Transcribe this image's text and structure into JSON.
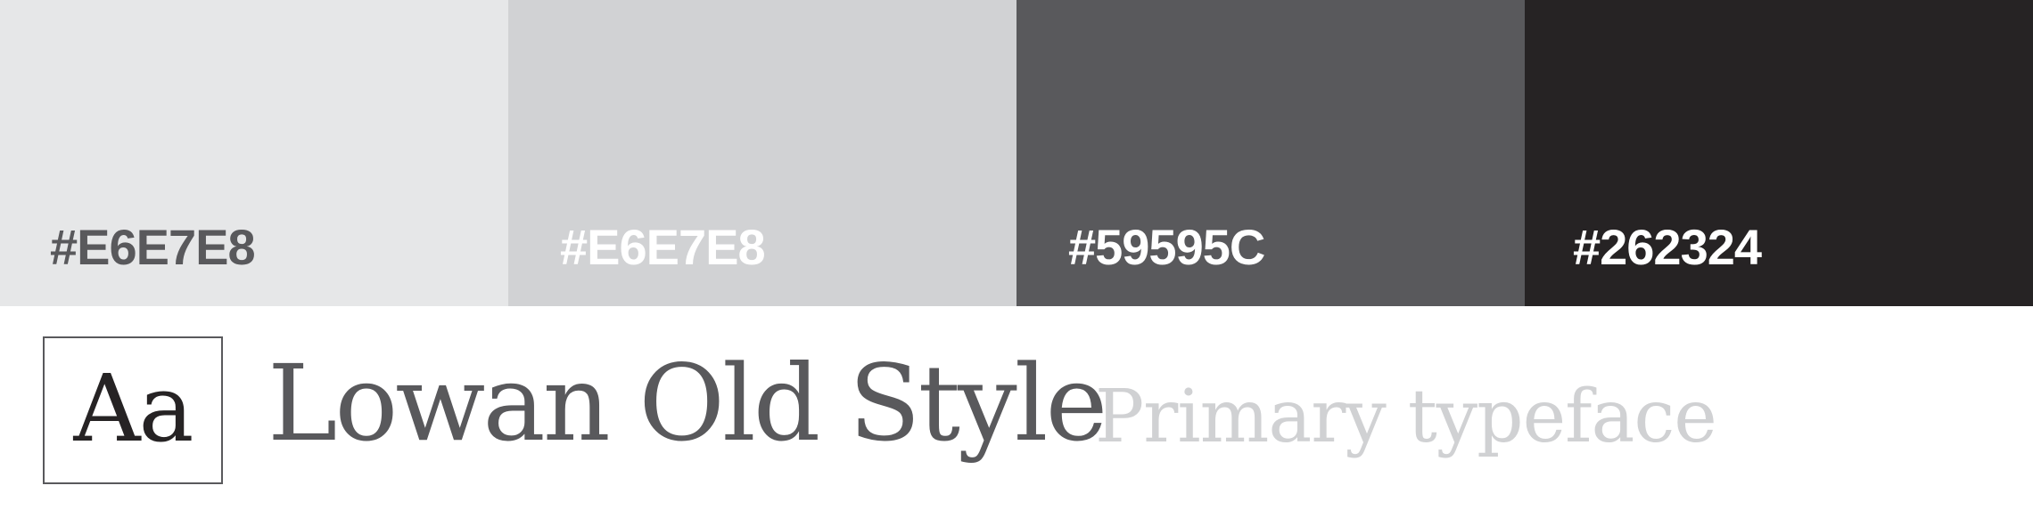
{
  "palette": {
    "swatches": [
      {
        "label": "#E6E7E8",
        "background": "#E6E7E8",
        "text_color": "#59595C"
      },
      {
        "label": "#E6E7E8",
        "background": "#D1D2D4",
        "text_color": "#ffffff"
      },
      {
        "label": "#59595C",
        "background": "#59595C",
        "text_color": "#ffffff"
      },
      {
        "label": "#262324",
        "background": "#262324",
        "text_color": "#ffffff"
      }
    ]
  },
  "typeface": {
    "sample": "Aa",
    "name": "Lowan Old Style",
    "role": "Primary typeface"
  }
}
